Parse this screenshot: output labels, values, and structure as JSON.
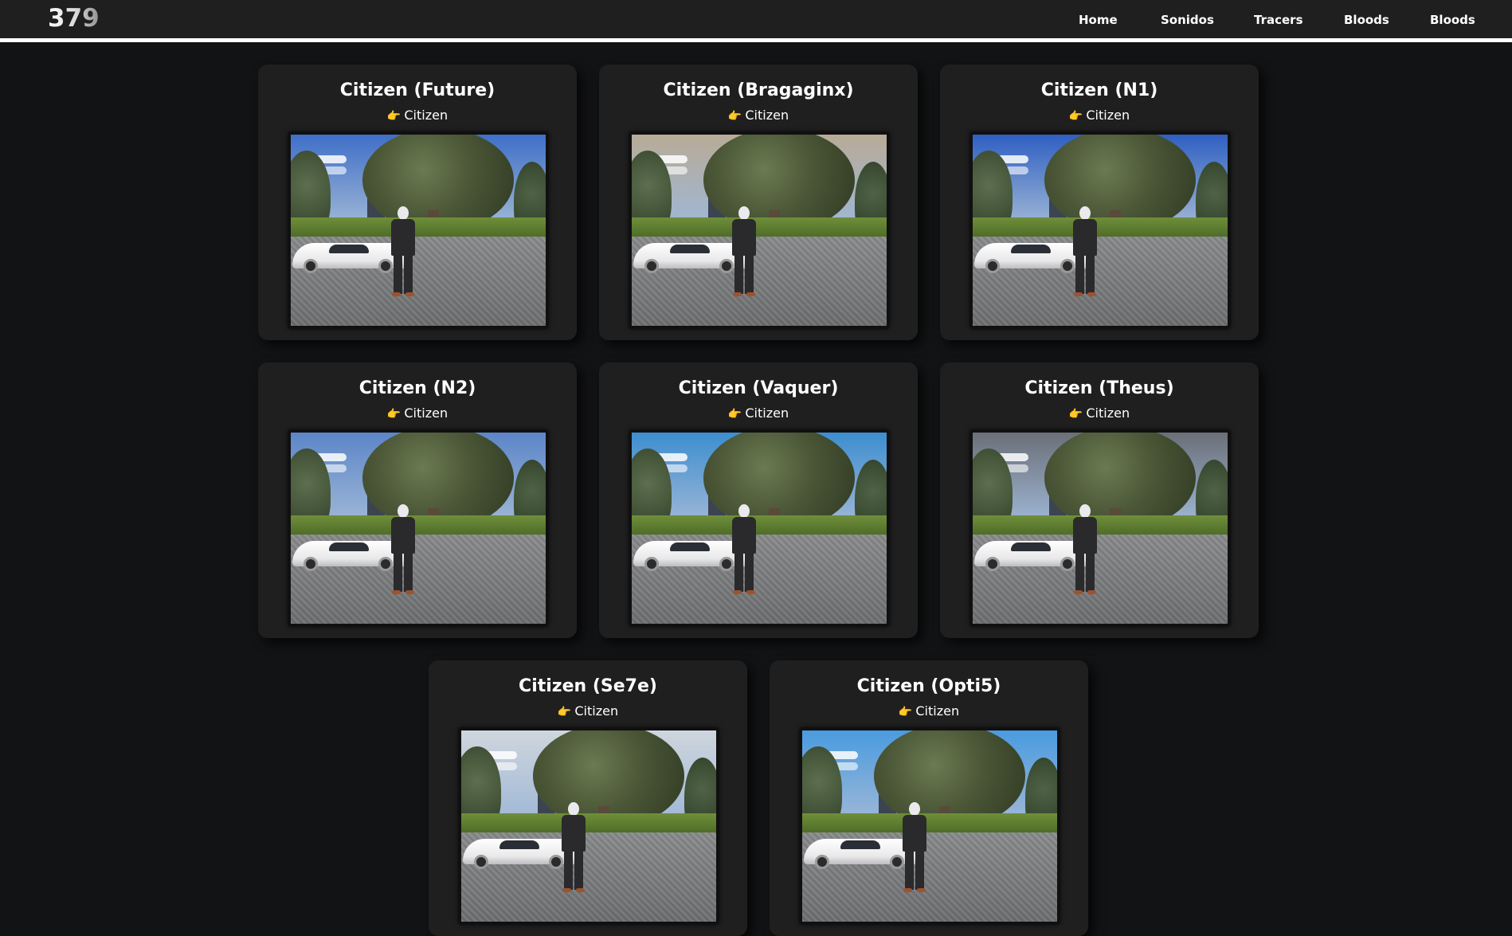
{
  "header": {
    "logo": "379",
    "nav": [
      "Home",
      "Sonidos",
      "Tracers",
      "Bloods",
      "Bloods"
    ]
  },
  "cards": [
    {
      "title": "Citizen (Future)",
      "role": "Citizen",
      "sky": "#3f6fc8"
    },
    {
      "title": "Citizen (Bragaginx)",
      "role": "Citizen",
      "sky": "#b8ab97"
    },
    {
      "title": "Citizen (N1)",
      "role": "Citizen",
      "sky": "#2f5fc2"
    },
    {
      "title": "Citizen (N2)",
      "role": "Citizen",
      "sky": "#5c86c8"
    },
    {
      "title": "Citizen (Vaquer)",
      "role": "Citizen",
      "sky": "#3d8ed0"
    },
    {
      "title": "Citizen (Theus)",
      "role": "Citizen",
      "sky": "#6b6f78"
    },
    {
      "title": "Citizen (Se7e)",
      "role": "Citizen",
      "sky": "#cfd6dd"
    },
    {
      "title": "Citizen (Opti5)",
      "role": "Citizen",
      "sky": "#4a9be0"
    }
  ],
  "icons": {
    "role": "pointing-hand-icon",
    "role_color": "#f2b233"
  }
}
